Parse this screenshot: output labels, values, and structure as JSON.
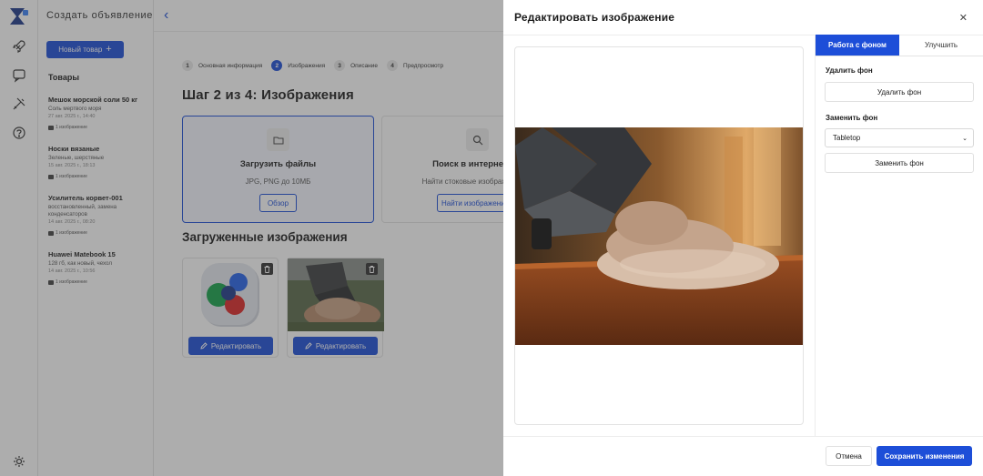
{
  "sidebar_header": "Создать объявление",
  "new_product_button": "Новый товар",
  "products_title": "Товары",
  "products": [
    {
      "name": "Мешок морской соли 50 кг",
      "desc": "Соль мертвого моря",
      "time": "27 авг. 2025 г., 14:40",
      "count": "1 изображение"
    },
    {
      "name": "Носки вязаные",
      "desc": "Зеленые, шерстяные",
      "time": "15 авг. 2025 г., 18:13",
      "count": "1 изображение"
    },
    {
      "name": "Усилитель корвет-001",
      "desc": "восстановленный, замена конденсаторов",
      "time": "14 авг. 2025 г., 08:20",
      "count": "1 изображение"
    },
    {
      "name": "Huawei Matebook 15",
      "desc": "128 гб, как новый, чехол",
      "time": "14 авг. 2025 г., 10:56",
      "count": "1 изображение"
    }
  ],
  "steps": [
    {
      "num": "1",
      "label": "Основная информация"
    },
    {
      "num": "2",
      "label": "Изображения"
    },
    {
      "num": "3",
      "label": "Описание"
    },
    {
      "num": "4",
      "label": "Предпросмотр"
    }
  ],
  "step_title": "Шаг 2 из 4: Изображения",
  "upload_card": {
    "title": "Загрузить файлы",
    "subtitle": "JPG, PNG до 10МБ",
    "button": "Обзор"
  },
  "stock_card": {
    "title": "Поиск в интернете",
    "subtitle": "Найти стоковые изображения",
    "button": "Найти изображения"
  },
  "uploaded_title": "Загруженные изображения",
  "edit_label": "Редактировать",
  "modal": {
    "title": "Редактировать изображение",
    "tab_background": "Работа с фоном",
    "tab_enhance": "Улучшить",
    "remove_bg_label": "Удалить фон",
    "remove_bg_button": "Удалить фон",
    "replace_bg_label": "Заменить фон",
    "replace_bg_select": "Tabletop",
    "replace_bg_button": "Заменить фон",
    "cancel": "Отмена",
    "save": "Сохранить изменения"
  },
  "colors": {
    "accent": "#1d4ed8"
  }
}
